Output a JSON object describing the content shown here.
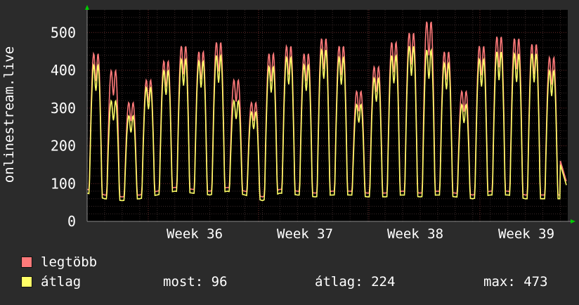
{
  "chart_data": {
    "type": "line",
    "ylabel": "onlinestream.live",
    "ylim": [
      0,
      560
    ],
    "yticks": [
      0,
      100,
      200,
      300,
      400,
      500
    ],
    "xticks": [
      "Week 36",
      "Week 37",
      "Week 38",
      "Week 39"
    ],
    "grid": true,
    "legend_placement": "bottom-left",
    "colors": {
      "background": "#2b2b2b",
      "plot_background": "#000000",
      "grid_minor": "#3a2a2a",
      "grid_major": "#6b2b2b",
      "axis_arrow": "#00cc00",
      "max_series": "#ff7a7a",
      "avg_series": "#ffff66"
    },
    "cycles": [
      {
        "max": 445,
        "avg": 415,
        "min": 75
      },
      {
        "max": 400,
        "avg": 320,
        "min": 60
      },
      {
        "max": 315,
        "avg": 280,
        "min": 55
      },
      {
        "max": 375,
        "avg": 355,
        "min": 60
      },
      {
        "max": 425,
        "avg": 400,
        "min": 70
      },
      {
        "max": 465,
        "avg": 430,
        "min": 80
      },
      {
        "max": 450,
        "avg": 425,
        "min": 75
      },
      {
        "max": 475,
        "avg": 440,
        "min": 70
      },
      {
        "max": 375,
        "avg": 320,
        "min": 80
      },
      {
        "max": 315,
        "avg": 290,
        "min": 70
      },
      {
        "max": 445,
        "avg": 410,
        "min": 55
      },
      {
        "max": 465,
        "avg": 435,
        "min": 75
      },
      {
        "max": 445,
        "avg": 415,
        "min": 70
      },
      {
        "max": 485,
        "avg": 455,
        "min": 65
      },
      {
        "max": 465,
        "avg": 435,
        "min": 70
      },
      {
        "max": 345,
        "avg": 310,
        "min": 70
      },
      {
        "max": 410,
        "avg": 380,
        "min": 65
      },
      {
        "max": 475,
        "avg": 440,
        "min": 65
      },
      {
        "max": 500,
        "avg": 465,
        "min": 70
      },
      {
        "max": 530,
        "avg": 455,
        "min": 65
      },
      {
        "max": 450,
        "avg": 420,
        "min": 70
      },
      {
        "max": 345,
        "avg": 310,
        "min": 65
      },
      {
        "max": 465,
        "avg": 430,
        "min": 60
      },
      {
        "max": 490,
        "avg": 450,
        "min": 70
      },
      {
        "max": 485,
        "avg": 445,
        "min": 70
      },
      {
        "max": 470,
        "avg": 445,
        "min": 60
      },
      {
        "max": 435,
        "avg": 400,
        "min": 60
      }
    ],
    "end_value": 96,
    "series": [
      {
        "name": "legtöbb",
        "color": "#ff7a7a"
      },
      {
        "name": "átlag",
        "color": "#ffff66"
      }
    ]
  },
  "stats": {
    "most": "most: 96",
    "atlag": "átlag: 224",
    "max": "max: 473"
  }
}
